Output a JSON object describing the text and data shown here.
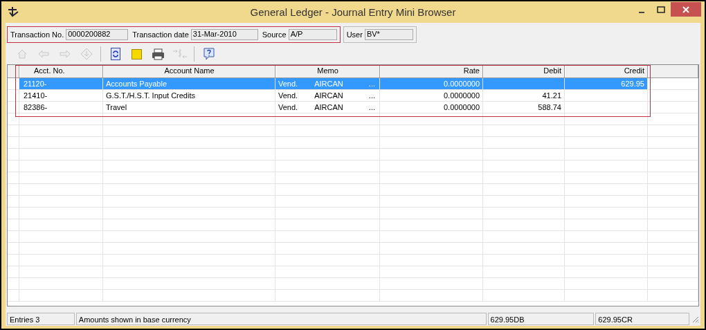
{
  "window": {
    "title": "General Ledger - Journal Entry Mini Browser"
  },
  "header_fields": [
    {
      "label": "Transaction No.",
      "value": "0000200882",
      "highlighted": true
    },
    {
      "label": "Transaction date",
      "value": "31-Mar-2010",
      "highlighted": true
    },
    {
      "label": "Source",
      "value": "A/P",
      "highlighted": true
    },
    {
      "label": "User",
      "value": "BV*",
      "highlighted": false
    }
  ],
  "toolbar": [
    {
      "kind": "home",
      "disabled": true
    },
    {
      "kind": "back",
      "disabled": true
    },
    {
      "kind": "forward",
      "disabled": true
    },
    {
      "kind": "drill",
      "disabled": true
    },
    {
      "kind": "separator"
    },
    {
      "kind": "refresh",
      "disabled": false
    },
    {
      "kind": "note",
      "disabled": false
    },
    {
      "kind": "print",
      "disabled": false
    },
    {
      "kind": "currency",
      "disabled": true
    },
    {
      "kind": "separator"
    },
    {
      "kind": "help",
      "disabled": false
    }
  ],
  "table": {
    "columns": [
      "Acct. No.",
      "Account Name",
      "Memo",
      "Rate",
      "Debit",
      "Credit"
    ],
    "rows": [
      {
        "account": "21120-",
        "name": "Accounts Payable",
        "memo": [
          "Vend.",
          "AIRCAN",
          "..."
        ],
        "rate": "0.0000000",
        "debit": "",
        "credit": "629.95",
        "selected": true
      },
      {
        "account": "21410-",
        "name": "G.S.T./H.S.T. Input Credits",
        "memo": [
          "Vend.",
          "AIRCAN",
          "..."
        ],
        "rate": "0.0000000",
        "debit": "41.21",
        "credit": "",
        "selected": false
      },
      {
        "account": "82386-",
        "name": "Travel",
        "memo": [
          "Vend.",
          "AIRCAN",
          "..."
        ],
        "rate": "0.0000000",
        "debit": "588.74",
        "credit": "",
        "selected": false
      }
    ]
  },
  "status_bar": [
    "Entries 3",
    "Amounts shown in base currency",
    "629.95DB",
    "629.95CR"
  ]
}
